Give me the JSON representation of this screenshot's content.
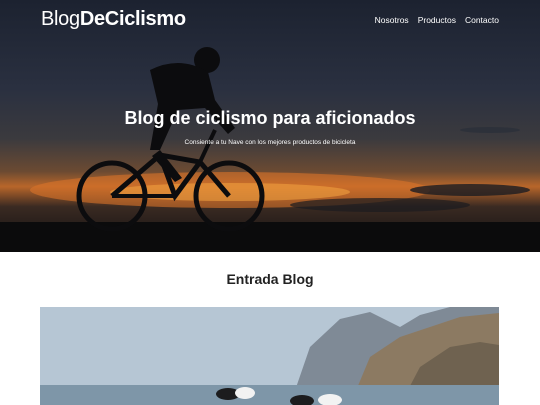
{
  "header": {
    "logo_light": "Blog",
    "logo_bold": "DeCiclismo",
    "nav": [
      {
        "label": "Nosotros"
      },
      {
        "label": "Productos"
      },
      {
        "label": "Contacto"
      }
    ]
  },
  "hero": {
    "title": "Blog de ciclismo para aficionados",
    "subtitle": "Consiente a tu Nave con los mejores productos de bicicleta"
  },
  "blog": {
    "section_title": "Entrada Blog"
  }
}
